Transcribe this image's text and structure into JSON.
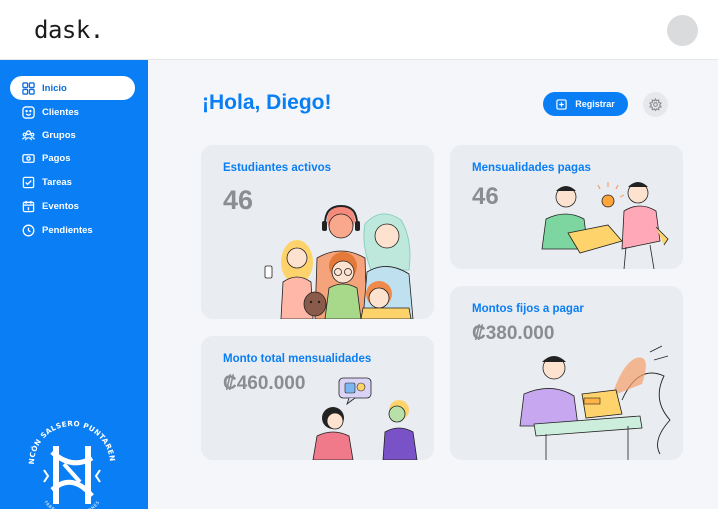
{
  "app": {
    "logo": "dask."
  },
  "sidebar": {
    "items": [
      {
        "label": "Inicio",
        "icon": "grid-icon",
        "active": true
      },
      {
        "label": "Clientes",
        "icon": "smile-icon",
        "active": false
      },
      {
        "label": "Grupos",
        "icon": "group-icon",
        "active": false
      },
      {
        "label": "Pagos",
        "icon": "money-icon",
        "active": false
      },
      {
        "label": "Tareas",
        "icon": "checklist-icon",
        "active": false
      },
      {
        "label": "Eventos",
        "icon": "calendar-icon",
        "active": false
      },
      {
        "label": "Pendientes",
        "icon": "clock-icon",
        "active": false
      }
    ],
    "emblem_text": "RINCÓN SALSERO PUNTARENAS · FÁBRICA DE CAMPEONES"
  },
  "header": {
    "greeting": "¡Hola, Diego!",
    "register_label": "Registrar"
  },
  "cards": {
    "active_students": {
      "title": "Estudiantes activos",
      "value": "46"
    },
    "paid_fees": {
      "title": "Mensualidades pagas",
      "value": "46"
    },
    "fixed_amounts": {
      "title": "Montos fijos a pagar",
      "value": "₡380.000"
    },
    "total_fees": {
      "title": "Monto total mensualidades",
      "value": "₡460.000"
    }
  },
  "colors": {
    "accent": "#0a7ef4",
    "card_bg": "#e9ecf0",
    "value_grey": "#8a8d92"
  }
}
